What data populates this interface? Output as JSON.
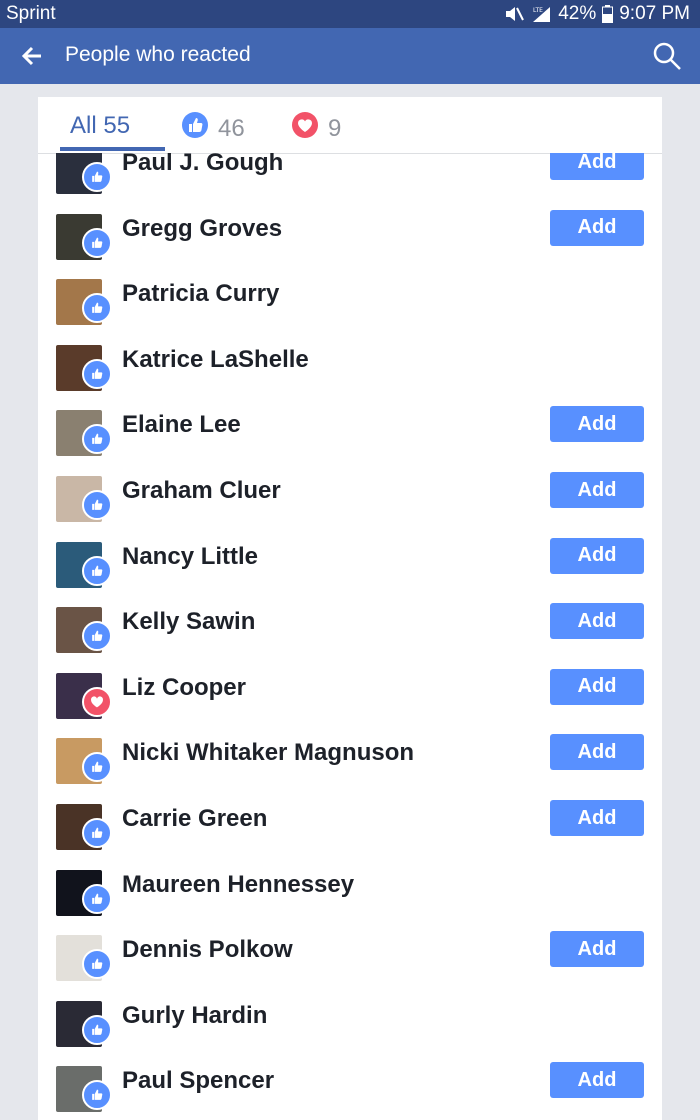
{
  "status_bar": {
    "carrier": "Sprint",
    "battery": "42%",
    "time": "9:07 PM"
  },
  "app_bar": {
    "title": "People who reacted"
  },
  "tabs": [
    {
      "label": "All 55",
      "icon": "none",
      "active": true
    },
    {
      "label": "46",
      "icon": "like-icon",
      "active": false
    },
    {
      "label": "9",
      "icon": "love-icon",
      "active": false
    }
  ],
  "add_label": "Add",
  "people": [
    {
      "name": "Paul J. Gough",
      "reaction": "like",
      "add": true,
      "avatar_color": "#2a2f3d"
    },
    {
      "name": "Gregg Groves",
      "reaction": "like",
      "add": true,
      "avatar_color": "#3a3a32"
    },
    {
      "name": "Patricia Curry",
      "reaction": "like",
      "add": false,
      "avatar_color": "#a3774a"
    },
    {
      "name": "Katrice LaShelle",
      "reaction": "like",
      "add": false,
      "avatar_color": "#5a3b2a"
    },
    {
      "name": "Elaine Lee",
      "reaction": "like",
      "add": true,
      "avatar_color": "#8a8070"
    },
    {
      "name": "Graham Cluer",
      "reaction": "like",
      "add": true,
      "avatar_color": "#c9b7a6"
    },
    {
      "name": "Nancy Little",
      "reaction": "like",
      "add": true,
      "avatar_color": "#2b5b7a"
    },
    {
      "name": "Kelly Sawin",
      "reaction": "like",
      "add": true,
      "avatar_color": "#6a5446"
    },
    {
      "name": "Liz Cooper",
      "reaction": "love",
      "add": true,
      "avatar_color": "#3a2f4a"
    },
    {
      "name": "Nicki Whitaker Magnuson",
      "reaction": "like",
      "add": true,
      "avatar_color": "#c89a62"
    },
    {
      "name": "Carrie Green",
      "reaction": "like",
      "add": true,
      "avatar_color": "#4a3326"
    },
    {
      "name": "Maureen Hennessey",
      "reaction": "like",
      "add": false,
      "avatar_color": "#11131c"
    },
    {
      "name": "Dennis Polkow",
      "reaction": "like",
      "add": true,
      "avatar_color": "#e3e0da"
    },
    {
      "name": "Gurly Hardin",
      "reaction": "like",
      "add": false,
      "avatar_color": "#2a2a35"
    },
    {
      "name": "Paul Spencer",
      "reaction": "like",
      "add": true,
      "avatar_color": "#6a6d6a"
    }
  ],
  "colors": {
    "accent": "#4267b2",
    "button": "#5890ff",
    "love": "#f25268"
  }
}
